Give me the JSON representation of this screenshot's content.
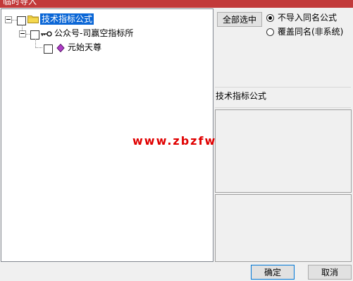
{
  "window": {
    "title": "临时导入"
  },
  "tree": {
    "root": {
      "label": "技术指标公式",
      "icon": "folder-icon"
    },
    "child": {
      "label": "公众号-司赢空指标所",
      "icon": "key-icon"
    },
    "leaf": {
      "label": "元始天尊",
      "icon": "gem-icon"
    }
  },
  "buttons": {
    "select_all": "全部选中",
    "ok": "确定",
    "cancel": "取消"
  },
  "options": {
    "no_import_same_name": "不导入同名公式",
    "overwrite_same_name": "覆盖同名(非系统)",
    "selected": "no_import_same_name"
  },
  "details": {
    "title": "技术指标公式"
  },
  "watermark": "www.zbzfwu.com",
  "colors": {
    "selection": "#0a66d6",
    "titlebar": "#c23a3a",
    "watermark": "#e00000"
  }
}
